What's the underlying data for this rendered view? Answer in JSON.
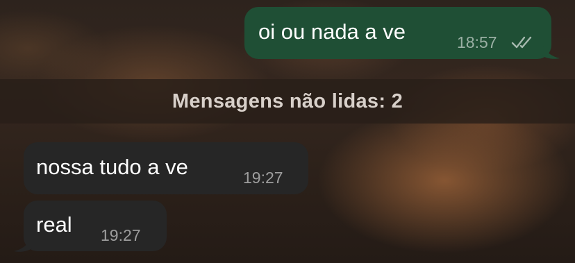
{
  "chat": {
    "messages": [
      {
        "direction": "outgoing",
        "text": "oi ou nada a ve",
        "time": "18:57",
        "status": "read-double-check-icon"
      },
      {
        "direction": "incoming",
        "text": "nossa tudo a ve",
        "time": "19:27"
      },
      {
        "direction": "incoming",
        "text": "real",
        "time": "19:27"
      }
    ],
    "unread_divider": "Mensagens não lidas: 2"
  },
  "colors": {
    "outgoing_bubble": "#1f4f35",
    "incoming_bubble": "#262626",
    "divider_background": "#281e18"
  }
}
